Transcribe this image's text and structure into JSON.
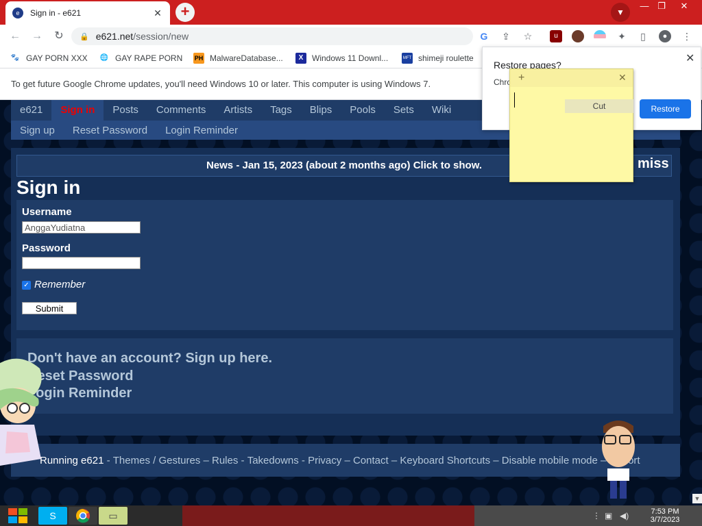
{
  "browser": {
    "tab_title": "Sign in - e621",
    "tab_favicon": "e621-favicon",
    "url_host": "e621.net",
    "url_path": "/session/new",
    "new_tab_symbol": "+",
    "tab_close": "✕",
    "window_controls": [
      "—",
      "❐",
      "✕"
    ]
  },
  "bookmarks": [
    {
      "icon": "bear-icon",
      "label": "GAY PORN XXX"
    },
    {
      "icon": "globe-icon",
      "label": "GAY RAPE PORN"
    },
    {
      "icon": "ph-icon",
      "glyph": "PH",
      "label": "MalwareDatabase..."
    },
    {
      "icon": "x-icon",
      "glyph": "X",
      "label": "Windows 11 Downl..."
    },
    {
      "icon": "mft-icon",
      "glyph": "MFT",
      "label": "shimeji roulette"
    }
  ],
  "infobar": {
    "message": "To get future Google Chrome updates, you'll need Windows 10 or later. This computer is using Windows 7."
  },
  "site": {
    "nav": [
      "e621",
      "Sign in",
      "Posts",
      "Comments",
      "Artists",
      "Tags",
      "Blips",
      "Pools",
      "Sets",
      "Wiki"
    ],
    "active_nav": "Sign in",
    "subnav": [
      "Sign up",
      "Reset Password",
      "Login Reminder"
    ],
    "news": "News - Jan 15, 2023 (about 2 months ago) Click to show.",
    "dismiss_fragment": "miss",
    "page_title": "Sign in",
    "form": {
      "username_label": "Username",
      "username_value": "AnggaYudiatna",
      "password_label": "Password",
      "password_value": "",
      "remember_label": "Remember",
      "remember_checked": true,
      "submit_label": "Submit"
    },
    "account_links": [
      "Don't have an account? Sign up here.",
      "Reset Password",
      "Login Reminder"
    ],
    "footer": {
      "running": "Running e621",
      "links": [
        "Themes / Gestures",
        "Rules",
        "Takedowns",
        "Privacy",
        "Contact",
        "Keyboard Shortcuts",
        "Disable mobile mode",
        "Report"
      ]
    }
  },
  "restore_popup": {
    "title": "Restore pages?",
    "body_fragment": "Chro",
    "button": "Restore"
  },
  "sticky_note": {
    "add_symbol": "+",
    "close_symbol": "✕",
    "context_item": "Cut"
  },
  "taskbar": {
    "time": "7:53 PM",
    "date": "3/7/2023",
    "apps": [
      "skype-icon",
      "chrome-icon",
      "sticky-notes-icon"
    ]
  },
  "colors": {
    "chrome_frame": "#cc1f1f",
    "site_bg": "#020f23",
    "site_nav": "#1f3c67",
    "site_link": "#b4c7d9",
    "active_nav": "#ee0000",
    "sticky": "#fef9a5",
    "accent_blue": "#1a73e8"
  }
}
